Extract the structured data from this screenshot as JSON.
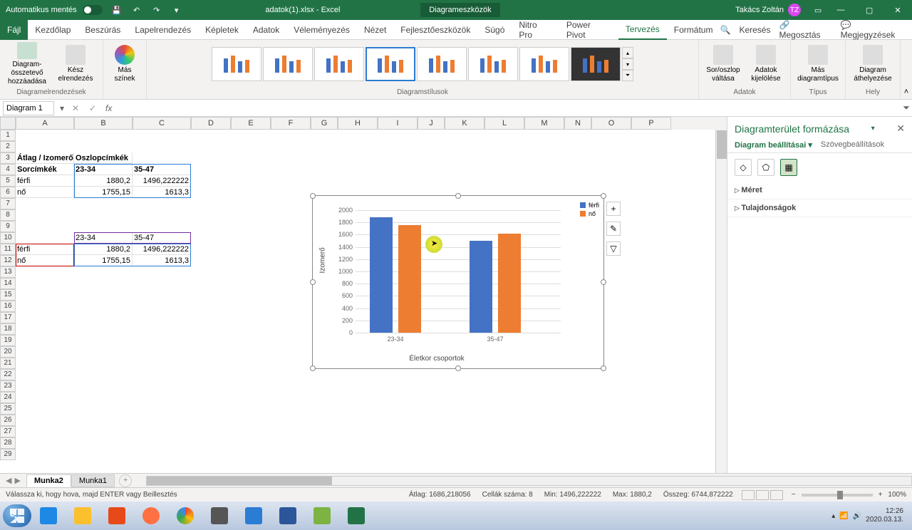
{
  "titlebar": {
    "autosave": "Automatikus mentés",
    "doc": "adatok(1).xlsx - Excel",
    "tools": "Diagrameszközök",
    "user": "Takács Zoltán",
    "user_initials": "TZ"
  },
  "ribbon_tabs": {
    "file": "Fájl",
    "home": "Kezdőlap",
    "insert": "Beszúrás",
    "pagelayout": "Lapelrendezés",
    "formulas": "Képletek",
    "data": "Adatok",
    "review": "Véleményezés",
    "view": "Nézet",
    "developer": "Fejlesztőeszközök",
    "help": "Súgó",
    "nitro": "Nitro Pro",
    "powerpivot": "Power Pivot",
    "design": "Tervezés",
    "format": "Formátum",
    "search": "Keresés",
    "share": "Megosztás",
    "comments": "Megjegyzések"
  },
  "ribbon": {
    "add_element": "Diagram-összetevő hozzáadása",
    "quick_layout": "Kész elrendezés",
    "change_colors": "Más színek",
    "group_layouts": "Diagramelrendezések",
    "group_styles": "Diagramstílusok",
    "switch": "Sor/oszlop váltása",
    "select_data": "Adatok kijelölése",
    "group_data": "Adatok",
    "change_type": "Más diagramtípus",
    "group_type": "Típus",
    "move_chart": "Diagram áthelyezése",
    "group_location": "Hely"
  },
  "namebox": "Diagram 1",
  "table": {
    "h_avg": "Átlag / Izomerő",
    "h_colhdr": "Oszlopcímkék",
    "h_rowhdr": "Sorcímkék",
    "c1": "23-34",
    "c2": "35-47",
    "r1": "férfi",
    "r2": "nő",
    "v11": "1880,2",
    "v12": "1496,222222",
    "v21": "1755,15",
    "v22": "1613,3"
  },
  "columns": [
    "A",
    "B",
    "C",
    "D",
    "E",
    "F",
    "G",
    "H",
    "I",
    "J",
    "K",
    "L",
    "M",
    "N",
    "O",
    "P"
  ],
  "chart_data": {
    "type": "bar",
    "categories": [
      "23-34",
      "35-47"
    ],
    "series": [
      {
        "name": "férfi",
        "values": [
          1880.2,
          1496.222222
        ],
        "color": "#4472C4"
      },
      {
        "name": "nő",
        "values": [
          1755.15,
          1613.3
        ],
        "color": "#ED7D31"
      }
    ],
    "ylabel": "Izomerő",
    "xlabel": "Életkor csoportok",
    "ylim": [
      0,
      2000
    ],
    "yticks": [
      0,
      200,
      400,
      600,
      800,
      1000,
      1200,
      1400,
      1600,
      1800,
      2000
    ]
  },
  "format_pane": {
    "title": "Diagramterület formázása",
    "tab_options": "Diagram beállításai",
    "tab_text": "Szövegbeállítások",
    "sec_size": "Méret",
    "sec_props": "Tulajdonságok"
  },
  "sheets": {
    "active": "Munka2",
    "other": "Munka1"
  },
  "status": {
    "msg": "Válassza ki, hogy hova, majd ENTER vagy Beillesztés",
    "avg": "Átlag: 1686,218056",
    "count": "Cellák száma: 8",
    "min": "Min: 1496,222222",
    "max": "Max: 1880,2",
    "sum": "Összeg: 6744,872222",
    "zoom": "100%"
  },
  "tray": {
    "time": "12:26",
    "date": "2020.03.13."
  }
}
